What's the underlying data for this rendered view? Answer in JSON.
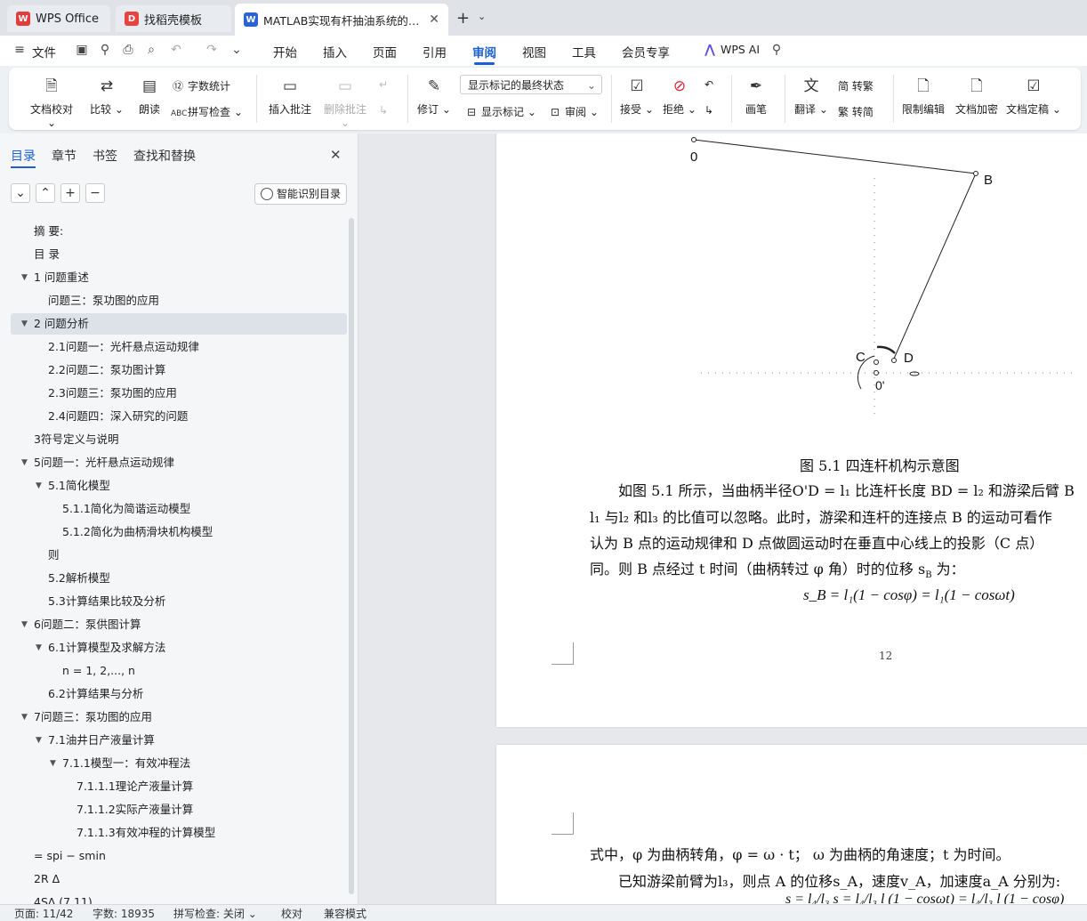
{
  "tabs": [
    {
      "label": "WPS Office",
      "icon": "wps-logo-icon"
    },
    {
      "label": "找稻壳模板",
      "icon": "docer-icon"
    },
    {
      "label": "MATLAB实现有杆抽油系统的…",
      "icon": "word-doc-icon",
      "active": true
    }
  ],
  "menu": {
    "file": "文件",
    "items": [
      "开始",
      "插入",
      "页面",
      "引用",
      "审阅",
      "视图",
      "工具",
      "会员专享"
    ],
    "active": "审阅",
    "wps_ai": "WPS AI"
  },
  "ribbon": {
    "proofread": "文档校对",
    "compare": "比较",
    "read_aloud": "朗读",
    "word_count": "字数统计",
    "spell_check": "拼写检查",
    "insert_comment": "插入批注",
    "delete_comment": "删除批注",
    "track_changes": "修订",
    "markup_state": "显示标记的最终状态",
    "show_markup": "显示标记",
    "review_pane": "审阅",
    "accept": "接受",
    "reject": "拒绝",
    "pen": "画笔",
    "translate": "翻译",
    "to_traditional": "简 转繁",
    "to_simplified": "繁 转简",
    "restrict_edit": "限制编辑",
    "encrypt": "文档加密",
    "finalize": "文档定稿"
  },
  "sidebar": {
    "tabs": [
      "目录",
      "章节",
      "书签",
      "查找和替换"
    ],
    "active_tab": "目录",
    "smart_toc": "智能识别目录",
    "toc": [
      {
        "label": "摘  要:",
        "level": 0,
        "arrow": ""
      },
      {
        "label": "目  录",
        "level": 0,
        "arrow": ""
      },
      {
        "label": "1 问题重述",
        "level": 0,
        "arrow": "▼"
      },
      {
        "label": "问题三：泵功图的应用",
        "level": 1,
        "arrow": ""
      },
      {
        "label": "2 问题分析",
        "level": 0,
        "arrow": "▼",
        "selected": true
      },
      {
        "label": "2.1问题一：光杆悬点运动规律",
        "level": 1,
        "arrow": ""
      },
      {
        "label": "2.2问题二：泵功图计算",
        "level": 1,
        "arrow": ""
      },
      {
        "label": "2.3问题三：泵功图的应用",
        "level": 1,
        "arrow": ""
      },
      {
        "label": "2.4问题四：深入研究的问题",
        "level": 1,
        "arrow": ""
      },
      {
        "label": "3符号定义与说明",
        "level": 0,
        "arrow": ""
      },
      {
        "label": "5问题一：光杆悬点运动规律",
        "level": 0,
        "arrow": "▼"
      },
      {
        "label": "5.1简化模型",
        "level": 1,
        "arrow": "▼"
      },
      {
        "label": "5.1.1简化为简谐运动模型",
        "level": 2,
        "arrow": ""
      },
      {
        "label": "5.1.2简化为曲柄滑块机构模型",
        "level": 2,
        "arrow": ""
      },
      {
        "label": "则",
        "level": 1,
        "arrow": ""
      },
      {
        "label": "5.2解析模型",
        "level": 1,
        "arrow": ""
      },
      {
        "label": "5.3计算结果比较及分析",
        "level": 1,
        "arrow": ""
      },
      {
        "label": "6问题二：泵供图计算",
        "level": 0,
        "arrow": "▼"
      },
      {
        "label": "6.1计算模型及求解方法",
        "level": 1,
        "arrow": "▼"
      },
      {
        "label": "n = 1, 2,..., n",
        "level": 2,
        "arrow": ""
      },
      {
        "label": "6.2计算结果与分析",
        "level": 1,
        "arrow": ""
      },
      {
        "label": "7问题三：泵功图的应用",
        "level": 0,
        "arrow": "▼"
      },
      {
        "label": "7.1油井日产液量计算",
        "level": 1,
        "arrow": "▼"
      },
      {
        "label": "7.1.1模型一：有效冲程法",
        "level": 2,
        "arrow": "▼"
      },
      {
        "label": "7.1.1.1理论产液量计算",
        "level": 3,
        "arrow": ""
      },
      {
        "label": "7.1.1.2实际产液量计算",
        "level": 3,
        "arrow": ""
      },
      {
        "label": "7.1.1.3有效冲程的计算模型",
        "level": 3,
        "arrow": ""
      },
      {
        "label": "= spi − smin",
        "level": 0,
        "arrow": ""
      },
      {
        "label": "2R Δ",
        "level": 0,
        "arrow": ""
      },
      {
        "label": "4S∆ (7.11)",
        "level": 0,
        "arrow": ""
      }
    ]
  },
  "document": {
    "figure_labels": {
      "o": "0",
      "b": "B",
      "c": "C",
      "d": "D",
      "o_prime": "0'"
    },
    "caption": "图  5.1 四连杆机构示意图",
    "para1_line1": "如图  5.1 所示，当曲柄半径O'D = l₁ 比连杆长度  BD = l₂ 和游梁后臂  B",
    "para1_line2": "l₁ 与l₂ 和l₃ 的比值可以忽略。此时，游梁和连杆的连接点 B 的运动可看作",
    "para1_line3": "认为 B 点的运动规律和 D 点做圆运动时在垂直中心线上的投影（C 点）",
    "para1_line4": "同。则 B 点经过  t 时间（曲柄转过 φ 角）时的位移  s",
    "para1_line4_sub": "B",
    "para1_line4_end": " 为：",
    "formula": "s_B = l₁(1 − cosφ) = l₁(1 − cosωt)",
    "page_number": "12",
    "para2_line1": "式中，φ 为曲柄转角，φ = ω · t；  ω 为曲柄的角速度；t 为时间。",
    "para2_line2": "已知游梁前臂为l₃，则点 A 的位移s_A，速度v_A，加速度a_A 分别为:",
    "para2_line3": "s = l₄/l₃ s = l₄/l₃ l (1 − cosωt) = l₄/l₃ l (1 − cosφ)"
  },
  "status": {
    "page": "页面: 11/42",
    "words": "字数: 18935",
    "spell": "拼写检查: 关闭",
    "proof": "校对",
    "compat": "兼容模式"
  }
}
